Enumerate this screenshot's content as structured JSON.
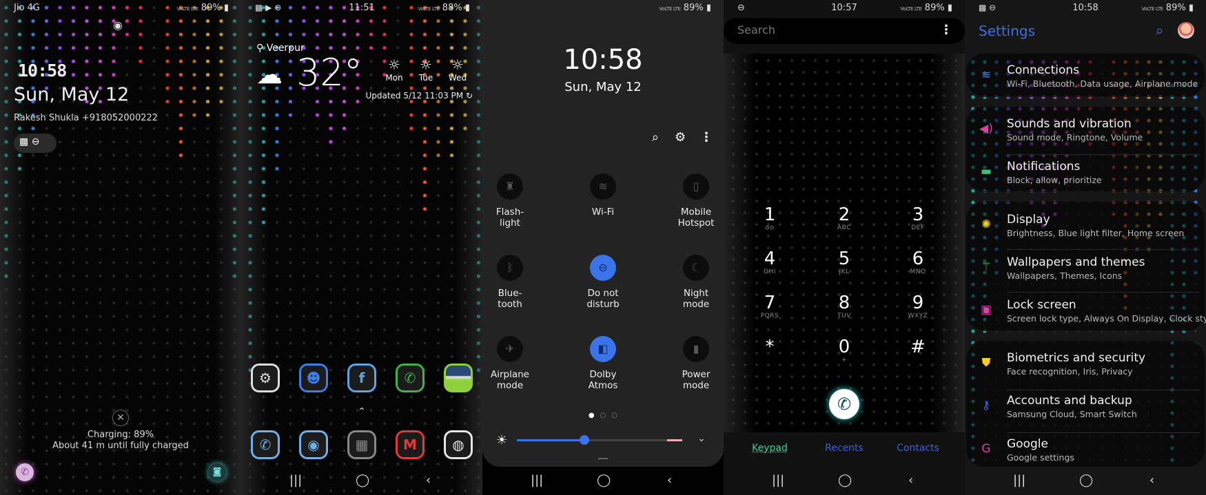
{
  "lock_screen": {
    "status": {
      "carrier": "Jio 4G",
      "network": "VoLTE LTE",
      "battery": "89%"
    },
    "clock": "10:58",
    "date": "Sun, May 12",
    "owner_info": "Rakesh Shukla +918052000222",
    "charging": "Charging: 89%",
    "charge_time": "About 41 m until fully charged",
    "icons": [
      "eye-icon",
      "image-icon",
      "dnd-icon",
      "close-icon",
      "phone-icon",
      "camera-icon"
    ]
  },
  "home_screen": {
    "status": {
      "time": "11:51",
      "network": "VoLTE LTE",
      "battery": "88%"
    },
    "weather": {
      "location": "Veerpur",
      "temperature": "32°",
      "condition": "cloudy",
      "forecast": [
        {
          "day": "Mon",
          "condition": "sunny"
        },
        {
          "day": "Tue",
          "condition": "sunny"
        },
        {
          "day": "Wed",
          "condition": "sunny"
        }
      ],
      "updated": "Updated 5/12 11:03 PM"
    },
    "apps_row1": [
      {
        "name": "Settings",
        "color": "#dddddd",
        "glyph": "⚙"
      },
      {
        "name": "Messages",
        "color": "#3d7fe6",
        "glyph": "☻"
      },
      {
        "name": "Facebook",
        "color": "#5aa6e6",
        "glyph": "f"
      },
      {
        "name": "WhatsApp",
        "color": "#3fb24a",
        "glyph": "✆"
      },
      {
        "name": "Gallery",
        "color": "#8fd03c",
        "glyph": ""
      }
    ],
    "apps_row2": [
      {
        "name": "Phone",
        "color": "#6fb0e8",
        "glyph": "✆"
      },
      {
        "name": "Camera",
        "color": "#6fb0e8",
        "glyph": "◉"
      },
      {
        "name": "Folder",
        "color": "#888888",
        "glyph": "▦"
      },
      {
        "name": "Gmail",
        "color": "#e03a3a",
        "glyph": "M"
      },
      {
        "name": "Chrome",
        "color": "#e6e6e6",
        "glyph": "◍"
      }
    ]
  },
  "quick_panel": {
    "status": {
      "network": "VoLTE LTE",
      "battery": "89%"
    },
    "clock": "10:58",
    "date": "Sun, May 12",
    "tiles": [
      {
        "label1": "Flash-",
        "label2": "light",
        "on": false,
        "icon": "flashlight-icon",
        "glyph": "♜"
      },
      {
        "label1": "Wi-Fi",
        "label2": "",
        "on": false,
        "icon": "wifi-icon",
        "glyph": "≋"
      },
      {
        "label1": "Mobile",
        "label2": "Hotspot",
        "on": false,
        "icon": "hotspot-icon",
        "glyph": "▯"
      },
      {
        "label1": "Blue-",
        "label2": "tooth",
        "on": false,
        "icon": "bluetooth-icon",
        "glyph": "ᛒ"
      },
      {
        "label1": "Do not",
        "label2": "disturb",
        "on": true,
        "icon": "dnd-icon",
        "glyph": "⊖"
      },
      {
        "label1": "Night",
        "label2": "mode",
        "on": false,
        "icon": "moon-icon",
        "glyph": "☾"
      },
      {
        "label1": "Airplane",
        "label2": "mode",
        "on": false,
        "icon": "airplane-icon",
        "glyph": "✈"
      },
      {
        "label1": "Dolby",
        "label2": "Atmos",
        "on": true,
        "icon": "dolby-icon",
        "glyph": "◧"
      },
      {
        "label1": "Power",
        "label2": "mode",
        "on": false,
        "icon": "battery-icon",
        "glyph": "▮"
      }
    ],
    "page": 1,
    "pages": 3,
    "brightness_percent": 41,
    "accent": "#3a74e8"
  },
  "dialer": {
    "status": {
      "time": "10:57",
      "network": "VoLTE LTE",
      "battery": "89%"
    },
    "search_placeholder": "Search",
    "keys": [
      {
        "d": "1",
        "s": "ᴑᴑ"
      },
      {
        "d": "2",
        "s": "ABC"
      },
      {
        "d": "3",
        "s": "DEF"
      },
      {
        "d": "4",
        "s": "GHI"
      },
      {
        "d": "5",
        "s": "JKL"
      },
      {
        "d": "6",
        "s": "MNO"
      },
      {
        "d": "7",
        "s": "PQRS"
      },
      {
        "d": "8",
        "s": "TUV"
      },
      {
        "d": "9",
        "s": "WXYZ"
      },
      {
        "d": "*",
        "s": ""
      },
      {
        "d": "0",
        "s": "+"
      },
      {
        "d": "#",
        "s": ""
      }
    ],
    "tabs": [
      {
        "label": "Keypad",
        "active": true
      },
      {
        "label": "Recents",
        "active": false
      },
      {
        "label": "Contacts",
        "active": false
      }
    ],
    "active_color": "#3fd0a0",
    "tab_color": "#3e5fd0"
  },
  "settings": {
    "status": {
      "time": "10:58",
      "network": "VoLTE LTE",
      "battery": "89%"
    },
    "title": "Settings",
    "title_color": "#3e6fe0",
    "items": [
      {
        "title": "Connections",
        "subtitle": "Wi-Fi, Bluetooth, Data usage, Airplane mode",
        "icon": "wifi-icon",
        "color": "#3e7fe6",
        "glyph": "≋"
      },
      {
        "title": "Sounds and vibration",
        "subtitle": "Sound mode, Ringtone, Volume",
        "icon": "speaker-icon",
        "color": "#e040a0",
        "glyph": "◀)"
      },
      {
        "title": "Notifications",
        "subtitle": "Block, allow, prioritize",
        "icon": "notification-icon",
        "color": "#40c070",
        "glyph": "▬"
      },
      {
        "title": "Display",
        "subtitle": "Brightness, Blue light filter, Home screen",
        "icon": "sun-icon",
        "color": "#f0d020",
        "glyph": "✺"
      },
      {
        "title": "Wallpapers and themes",
        "subtitle": "Wallpapers, Themes, Icons",
        "icon": "brush-icon",
        "color": "#40d070",
        "glyph": "⚚"
      },
      {
        "title": "Lock screen",
        "subtitle": "Screen lock type, Always On Display, Clock style",
        "icon": "lock-icon",
        "color": "#e040b0",
        "glyph": "▣"
      },
      {
        "title": "Biometrics and security",
        "subtitle": "Face recognition, Iris, Privacy",
        "icon": "shield-icon",
        "color": "#f0d020",
        "glyph": "⛊"
      },
      {
        "title": "Accounts and backup",
        "subtitle": "Samsung Cloud, Smart Switch",
        "icon": "key-icon",
        "color": "#3e6fe0",
        "glyph": "⚷"
      },
      {
        "title": "Google",
        "subtitle": "Google settings",
        "icon": "google-icon",
        "color": "#e040a0",
        "glyph": "G"
      }
    ]
  }
}
